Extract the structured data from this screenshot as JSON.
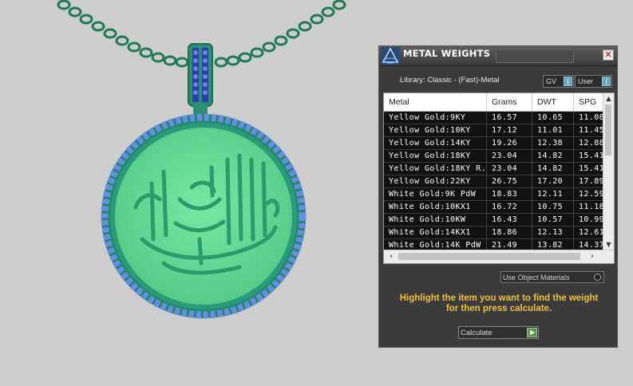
{
  "panel": {
    "title": "METAL WEIGHTS",
    "close_label": "✕",
    "library_label": "Library: Classic - (Fast)-Metal",
    "toggle_gv_label": "GV",
    "toggle_user_label": "User",
    "use_object_materials_label": "Use Object Materials",
    "hint_line1": "Highlight the item you want to find the weight",
    "hint_line2": "for then press calculate.",
    "calculate_label": "Calculate"
  },
  "table": {
    "headers": [
      "Metal",
      "Grams",
      "DWT",
      "SPG"
    ],
    "rows": [
      [
        "Yellow Gold:9KY",
        "16.57",
        "10.65",
        "11.08"
      ],
      [
        "Yellow Gold:10KY",
        "17.12",
        "11.01",
        "11.45"
      ],
      [
        "Yellow Gold:14KY",
        "19.26",
        "12.38",
        "12.88"
      ],
      [
        "Yellow Gold:18KY",
        "23.04",
        "14.82",
        "15.41"
      ],
      [
        "Yellow Gold:18KY R...",
        "23.04",
        "14.82",
        "15.41"
      ],
      [
        "Yellow Gold:22KY",
        "26.75",
        "17.20",
        "17.89"
      ],
      [
        "White Gold:9K PdW",
        "18.83",
        "12.11",
        "12.59"
      ],
      [
        "White Gold:10KX1",
        "16.72",
        "10.75",
        "11.18"
      ],
      [
        "White Gold:10KW",
        "16.43",
        "10.57",
        "10.99"
      ],
      [
        "White Gold:14KX1",
        "18.86",
        "12.13",
        "12.61"
      ],
      [
        "White Gold:14K PdW",
        "21.49",
        "13.82",
        "14.37"
      ]
    ]
  },
  "scene": {
    "pendant_color": "#6ee09a",
    "rim_color": "#2b8f76",
    "stone_color": "#5a6fd8",
    "chain_color": "#1f7a55"
  }
}
